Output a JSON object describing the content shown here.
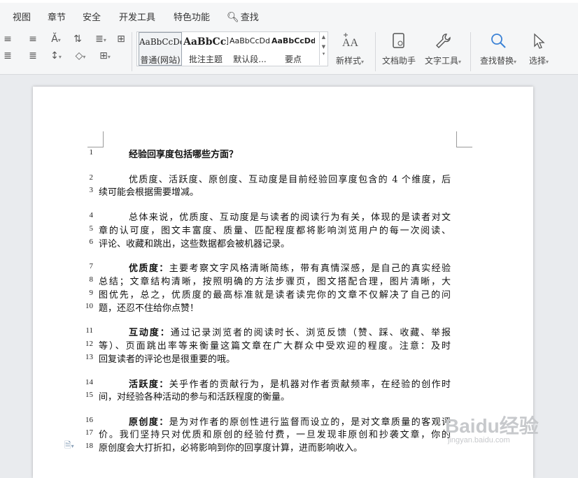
{
  "menu": {
    "tabs": [
      "视图",
      "章节",
      "安全",
      "开发工具",
      "特色功能"
    ],
    "search_label": "查找"
  },
  "styles": [
    {
      "preview": "AaBbCcDd",
      "name": "普通(网站)",
      "selected": true
    },
    {
      "preview": "AaBbCcI",
      "name": "批注主题",
      "selected": false
    },
    {
      "preview": "AaBbCcDd",
      "name": "默认段...",
      "selected": false
    },
    {
      "preview": "AaBbCcDd",
      "name": "要点",
      "selected": false
    }
  ],
  "ribbon": {
    "new_style": "新样式",
    "doc_assistant": "文档助手",
    "text_tools": "文字工具",
    "find_replace": "查找替换",
    "select": "选择"
  },
  "document": {
    "lines": [
      {
        "n": "1",
        "t": "经验回享度包括哪些方面？"
      },
      {
        "n": "2",
        "t": "优质度、活跃度、原创度、互动度是目前经验回享度包含的 4 个维度，后"
      },
      {
        "n": "3",
        "t": "续可能会根据需要增减。"
      },
      {
        "n": "4",
        "t": "总体来说，优质度、互动度是与读者的阅读行为有关，体现的是读者对文"
      },
      {
        "n": "5",
        "t": "章的认可度，图文丰富度、质量、匹配程度都将影响浏览用户的每一次阅读、"
      },
      {
        "n": "6",
        "t": "评论、收藏和跳出，这些数据都会被机器记录。"
      },
      {
        "n": "7",
        "b": "优质度：",
        "t": "主要考察文字风格清晰简练，带有真情深感，是自己的真实经验"
      },
      {
        "n": "8",
        "t": "总结；文章结构清晰，按照明确的方法步骤页，图文搭配合理，图片清晰，大"
      },
      {
        "n": "9",
        "t": "图优先，总之，优质度的最高标准就是读者读完你的文章不仅解决了自己的问"
      },
      {
        "n": "10",
        "t": "题，还忍不住给你点赞！"
      },
      {
        "n": "11",
        "b": "互动度：",
        "t": "通过记录浏览者的阅读时长、浏览反馈（赞、踩、收藏、举报"
      },
      {
        "n": "12",
        "t": "等）、页面跳出率等来衡量这篇文章在广大群众中受欢迎的程度。注意：及时"
      },
      {
        "n": "13",
        "t": "回复读者的评论也是很重要的哦。"
      },
      {
        "n": "14",
        "b": "活跃度：",
        "t": "关乎作者的贡献行为，是机器对作者贡献频率，在经验的创作时"
      },
      {
        "n": "15",
        "t": "间，对经验各种活动的参与和活跃程度的衡量。"
      },
      {
        "n": "16",
        "b": "原创度：",
        "t": "是为对作者的原创性进行监督而设立的，是对文章质量的客观评"
      },
      {
        "n": "17",
        "t": "价。我们坚持只对优质和原创的经验付费，一旦发现非原创和抄袭文章，你的"
      },
      {
        "n": "18",
        "t": "原创度会大打折扣，必将影响到你的回享度计算，进而影响收入。"
      }
    ]
  },
  "watermark": {
    "brand": "Baidu经验",
    "url": "jingyan.baidu.com"
  }
}
